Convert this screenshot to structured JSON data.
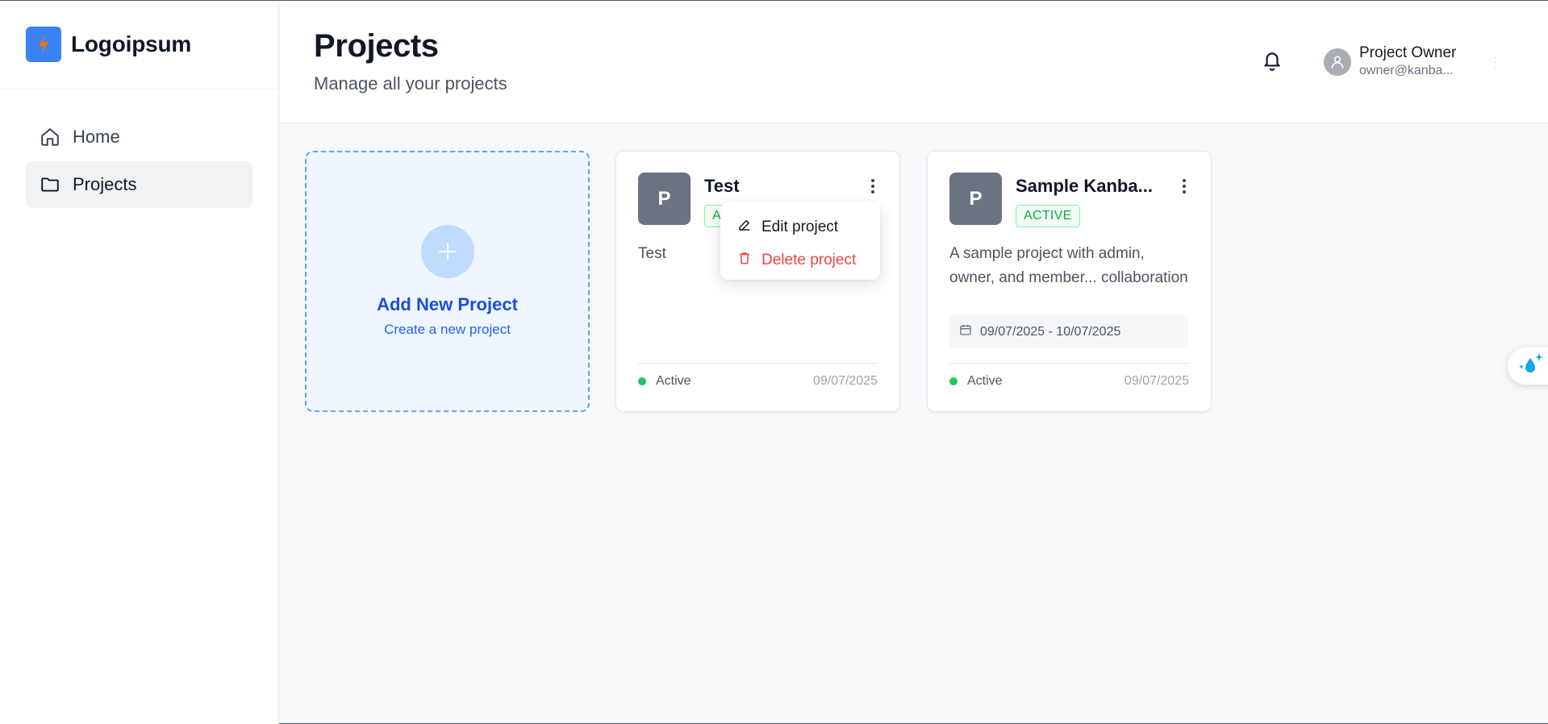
{
  "brand": {
    "name": "Logoipsum",
    "logo_icon": "lightning-bolt-icon",
    "logo_color": "#3b82f6"
  },
  "sidebar": {
    "items": [
      {
        "label": "Home",
        "icon": "home-icon",
        "active": false
      },
      {
        "label": "Projects",
        "icon": "folder-icon",
        "active": true
      }
    ]
  },
  "header": {
    "title": "Projects",
    "subtitle": "Manage all your projects",
    "user": {
      "name": "Project Owner",
      "email": "owner@kanba..."
    }
  },
  "add_card": {
    "title": "Add New Project",
    "subtitle": "Create a new project"
  },
  "projects": [
    {
      "avatar_letter": "P",
      "name": "Test",
      "badge": "ACTIVE",
      "description": "Test",
      "status": "Active",
      "date": "09/07/2025"
    },
    {
      "avatar_letter": "P",
      "name": "Sample Kanba...",
      "badge": "ACTIVE",
      "description": "A sample project with admin, owner, and member... collaboration",
      "date_range": "09/07/2025 - 10/07/2025",
      "status": "Active",
      "date": "09/07/2025"
    }
  ],
  "menu": {
    "items": [
      {
        "label": "Edit project",
        "icon": "pencil-icon"
      },
      {
        "label": "Delete project",
        "icon": "trash-icon"
      }
    ]
  },
  "colors": {
    "accent": "#2563eb",
    "status_active": "#22c55e",
    "danger": "#ef4444",
    "badge_green": "#16a34a"
  }
}
